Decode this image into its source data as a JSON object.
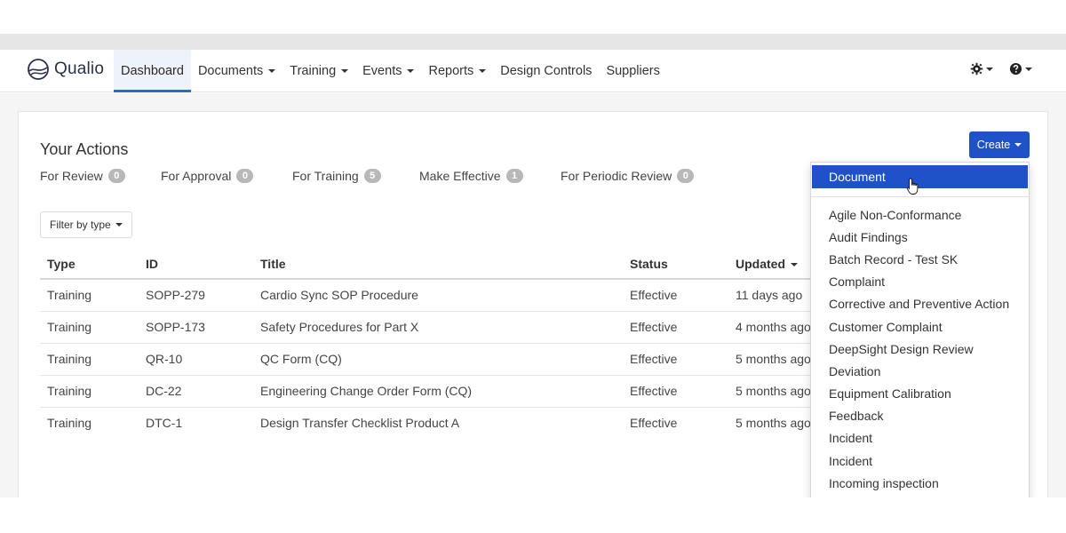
{
  "app": {
    "name": "Qualio"
  },
  "nav": {
    "items": [
      {
        "label": "Dashboard",
        "dropdown": false,
        "active": true
      },
      {
        "label": "Documents",
        "dropdown": true
      },
      {
        "label": "Training",
        "dropdown": true
      },
      {
        "label": "Events",
        "dropdown": true
      },
      {
        "label": "Reports",
        "dropdown": true
      },
      {
        "label": "Design Controls",
        "dropdown": false
      },
      {
        "label": "Suppliers",
        "dropdown": false
      }
    ],
    "right_icons": [
      "settings-icon",
      "help-icon"
    ]
  },
  "page": {
    "title": "Your Actions",
    "tabs": [
      {
        "label": "For Review",
        "count": "0"
      },
      {
        "label": "For Approval",
        "count": "0"
      },
      {
        "label": "For Training",
        "count": "5"
      },
      {
        "label": "Make Effective",
        "count": "1"
      },
      {
        "label": "For Periodic Review",
        "count": "0"
      }
    ],
    "filter_label": "Filter by type",
    "create_label": "Create"
  },
  "table": {
    "columns": [
      "Type",
      "ID",
      "Title",
      "Status",
      "Updated"
    ],
    "rows": [
      [
        "Training",
        "SOPP-279",
        "Cardio Sync SOP Procedure",
        "Effective",
        "11 days ago"
      ],
      [
        "Training",
        "SOPP-173",
        "Safety Procedures for Part X",
        "Effective",
        "4 months ago"
      ],
      [
        "Training",
        "QR-10",
        "QC Form (CQ)",
        "Effective",
        "5 months ago"
      ],
      [
        "Training",
        "DC-22",
        "Engineering Change Order Form (CQ)",
        "Effective",
        "5 months ago"
      ],
      [
        "Training",
        "DTC-1",
        "Design Transfer Checklist Product A",
        "Effective",
        "5 months ago"
      ]
    ]
  },
  "create_menu": {
    "highlighted": "Document",
    "items": [
      "Agile Non-Conformance",
      "Audit Findings",
      "Batch Record - Test SK",
      "Complaint",
      "Corrective and Preventive Action",
      "Customer Complaint",
      "DeepSight Design Review",
      "Deviation",
      "Equipment Calibration",
      "Feedback",
      "Incident",
      "Incident",
      "Incoming inspection"
    ]
  },
  "colors": {
    "accent": "#1f52c8",
    "nav_active_underline": "#2e64d6",
    "badge": "#b8b8b8"
  }
}
